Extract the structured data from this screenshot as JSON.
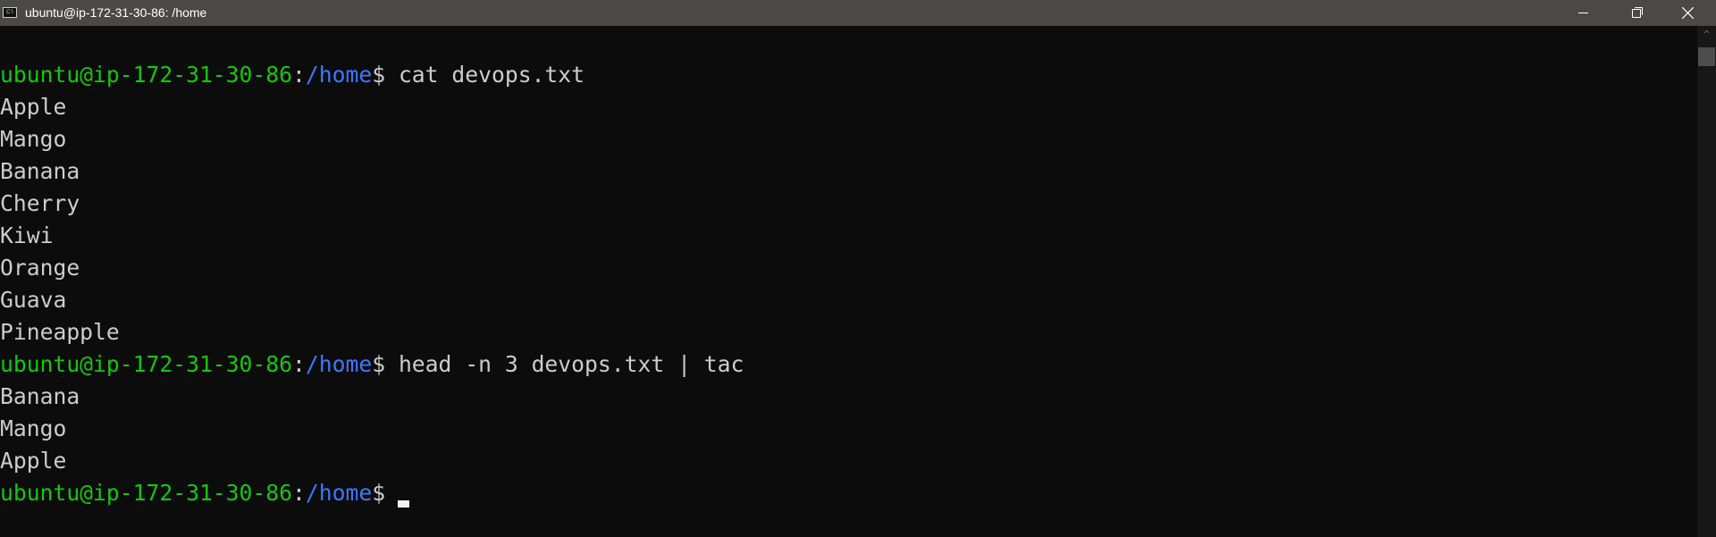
{
  "window": {
    "title": "ubuntu@ip-172-31-30-86: /home",
    "icon": "terminal-icon",
    "controls": [
      "minimize-icon",
      "restore-icon",
      "close-icon"
    ]
  },
  "colors": {
    "background": "#0c0c0c",
    "user_host": "#16c60c",
    "path": "#3b78ff",
    "text": "#cccccc"
  },
  "prompt": {
    "user_host": "ubuntu@ip-172-31-30-86",
    "colon": ":",
    "path": "/home",
    "symbol": "$ "
  },
  "commands": [
    {
      "command": "cat devops.txt",
      "output": [
        "Apple",
        "Mango",
        "Banana",
        "Cherry",
        "Kiwi",
        "Orange",
        "Guava",
        "Pineapple"
      ]
    },
    {
      "command": "head -n 3 devops.txt | tac",
      "output": [
        "Banana",
        "Mango",
        "Apple"
      ]
    }
  ],
  "current_input": ""
}
